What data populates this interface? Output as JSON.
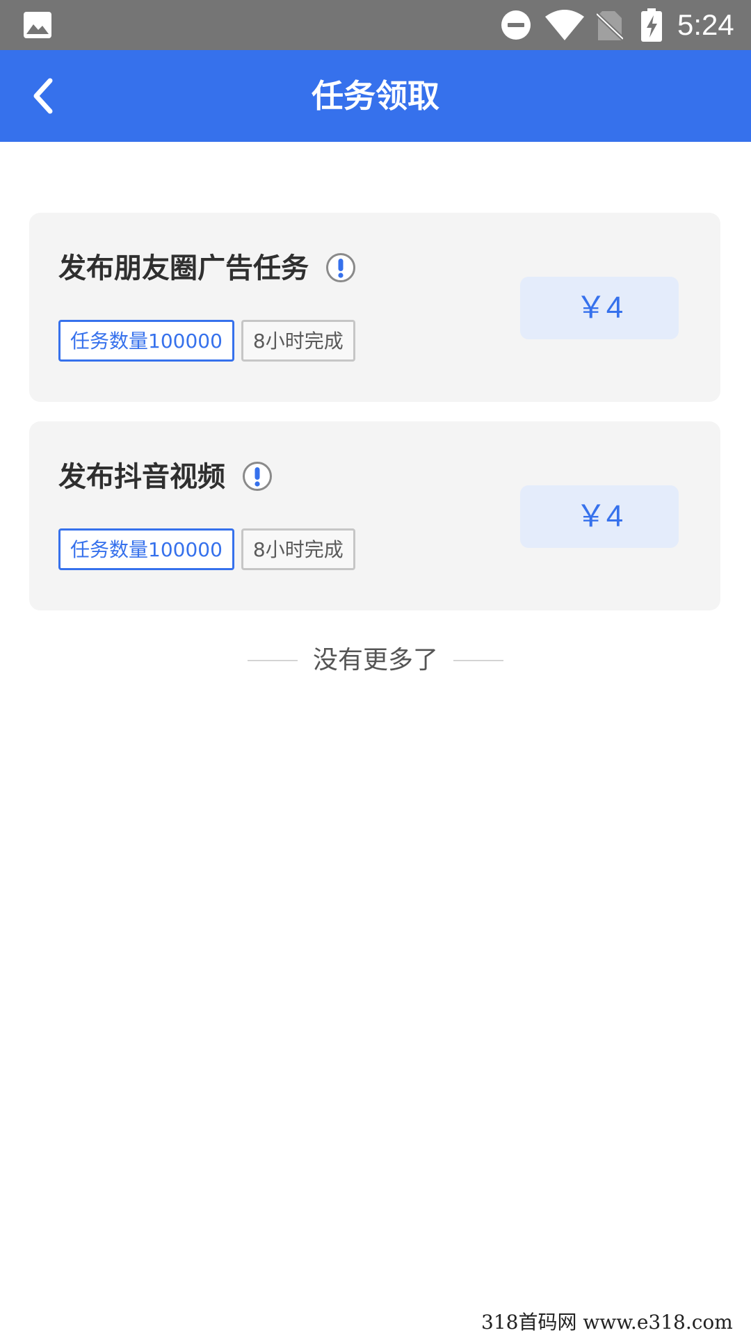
{
  "status_bar": {
    "time": "5:24",
    "icons": [
      "gallery-icon",
      "do-not-disturb-icon",
      "wifi-icon",
      "no-sim-icon",
      "battery-charging-icon"
    ]
  },
  "app_bar": {
    "title": "任务领取",
    "back_icon": "chevron-left-icon",
    "color": "#3671ec"
  },
  "tasks": [
    {
      "title": "发布朋友圈广告任务",
      "count_label": "任务数量100000",
      "time_label": "8小时完成",
      "reward": "￥4"
    },
    {
      "title": "发布抖音视频",
      "count_label": "任务数量100000",
      "time_label": "8小时完成",
      "reward": "￥4"
    }
  ],
  "footer": {
    "end_text": "没有更多了"
  },
  "watermark": {
    "text": "318首码网   www.e318.com"
  }
}
